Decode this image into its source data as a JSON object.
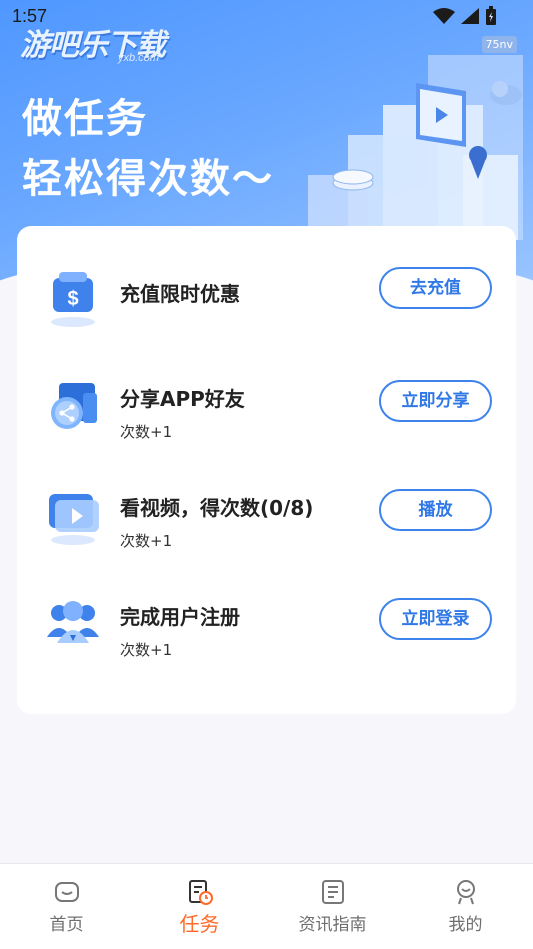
{
  "status": {
    "time": "1:57",
    "tag": "75nv"
  },
  "branding": {
    "logo": "游吧乐下载",
    "logo_sub": "yxb.com"
  },
  "hero": {
    "line1": "做任务",
    "line2": "轻松得次数～"
  },
  "tasks": [
    {
      "title": "充值限时优惠",
      "sub": "",
      "button": "去充值",
      "icon": "dollar-wallet-icon"
    },
    {
      "title": "分享APP好友",
      "sub": "次数+1",
      "button": "立即分享",
      "icon": "share-icon"
    },
    {
      "title": "看视频，得次数(0/8)",
      "sub": "次数+1",
      "button": "播放",
      "icon": "video-play-icon"
    },
    {
      "title": "完成用户注册",
      "sub": "次数+1",
      "button": "立即登录",
      "icon": "user-register-icon"
    }
  ],
  "tabs": [
    {
      "label": "首页",
      "icon": "home-icon"
    },
    {
      "label": "任务",
      "icon": "task-icon"
    },
    {
      "label": "资讯指南",
      "icon": "news-icon"
    },
    {
      "label": "我的",
      "icon": "profile-icon"
    }
  ],
  "colors": {
    "accent": "#3e84ec",
    "active_tab": "#ff6a2a",
    "hero_blue": "#4f97ff"
  }
}
